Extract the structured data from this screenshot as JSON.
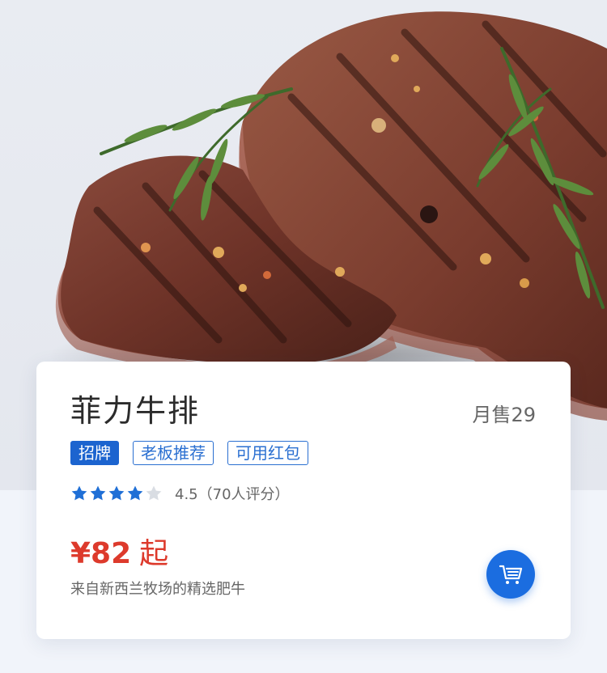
{
  "product": {
    "name": "菲力牛排",
    "monthly_sales": "月售29",
    "tags": [
      {
        "label": "招牌",
        "style": "filled"
      },
      {
        "label": "老板推荐",
        "style": "outline"
      },
      {
        "label": "可用红包",
        "style": "outline"
      }
    ],
    "rating": {
      "stars_filled": 4,
      "stars_total": 5,
      "text": "4.5（70人评分）"
    },
    "price": "¥82",
    "price_suffix": "起",
    "description": "来自新西兰牧场的精选肥牛",
    "image": "grilled-steak-with-rosemary"
  },
  "icons": {
    "cart": "shopping-cart-icon",
    "star": "star-icon"
  },
  "colors": {
    "accent": "#1c64cf",
    "price": "#dd3a2c",
    "star_filled": "#1f6fd6",
    "star_empty": "#d9dde3"
  }
}
